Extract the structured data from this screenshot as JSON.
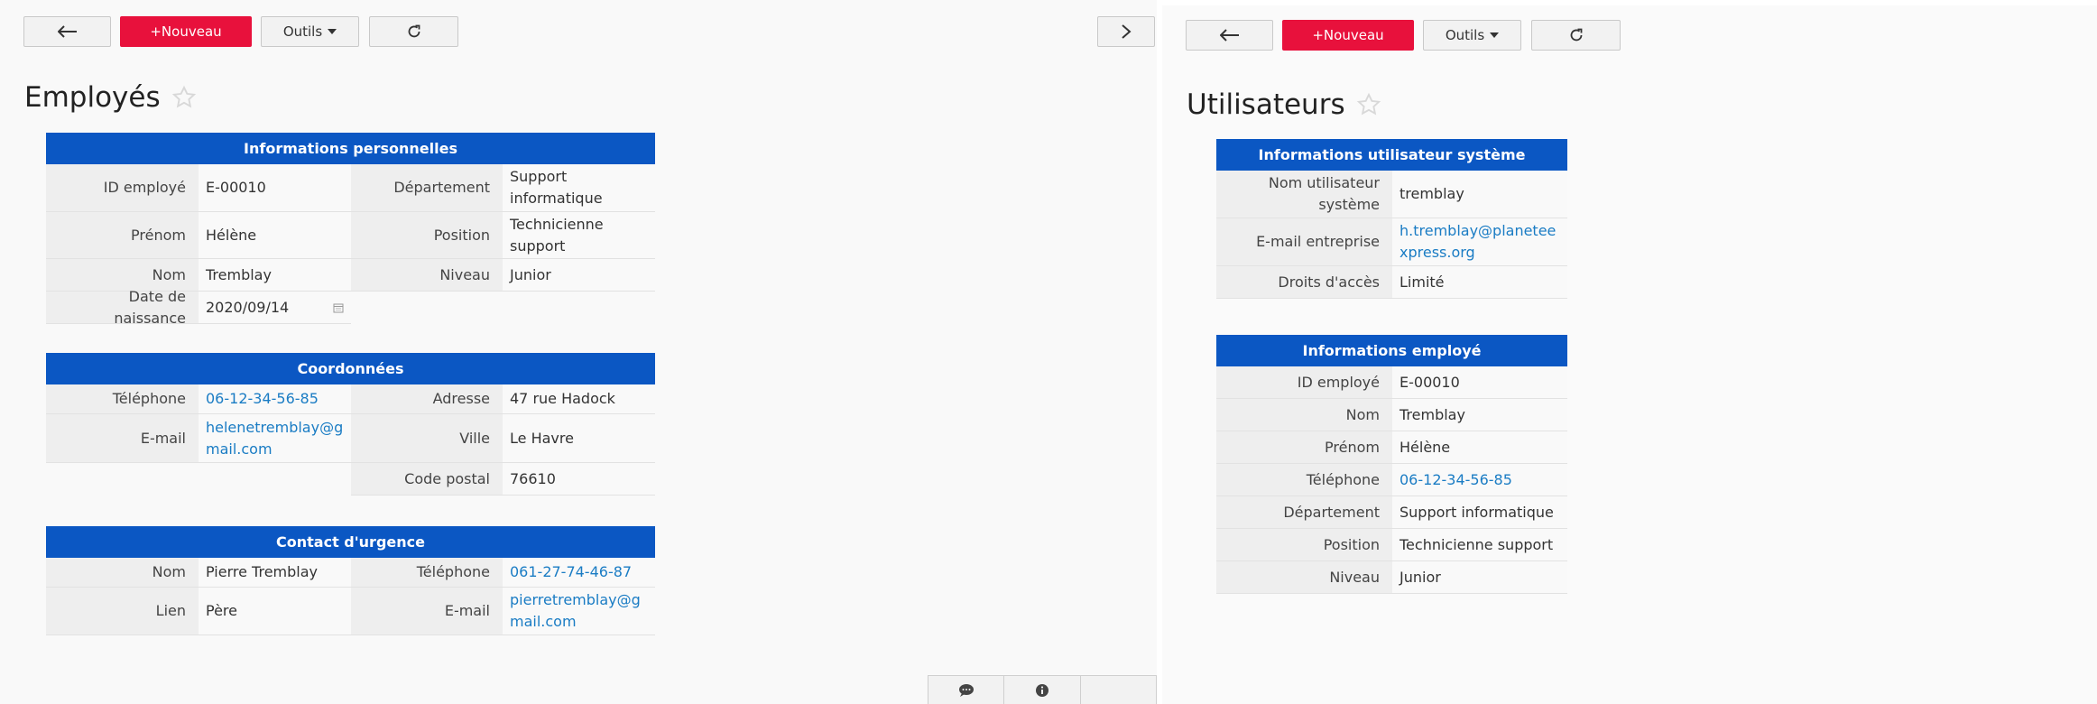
{
  "colors": {
    "accent_red": "#e8113c",
    "header_blue": "#0b57c3",
    "link_blue": "#1a7cc4"
  },
  "left": {
    "toolbar": {
      "back_icon": "arrow-left-icon",
      "new_label": "+Nouveau",
      "tools_label": "Outils",
      "refresh_icon": "refresh-icon",
      "forward_icon": "chevron-right-icon"
    },
    "title": "Employés",
    "personal": {
      "header": "Informations personnelles",
      "employee_id_label": "ID employé",
      "employee_id": "E-00010",
      "department_label": "Département",
      "department": "Support informatique",
      "first_name_label": "Prénom",
      "first_name": "Hélène",
      "position_label": "Position",
      "position": "Technicienne support",
      "last_name_label": "Nom",
      "last_name": "Tremblay",
      "level_label": "Niveau",
      "level": "Junior",
      "birthdate_label": "Date de naissance",
      "birthdate": "2020/09/14"
    },
    "contact": {
      "header": "Coordonnées",
      "phone_label": "Téléphone",
      "phone": "06-12-34-56-85",
      "address_label": "Adresse",
      "address": "47 rue Hadock",
      "email_label": "E-mail",
      "email": "helenetremblay@gmail.com",
      "city_label": "Ville",
      "city": "Le Havre",
      "postal_label": "Code postal",
      "postal": "76610"
    },
    "emergency": {
      "header": "Contact d'urgence",
      "name_label": "Nom",
      "name": "Pierre Tremblay",
      "phone_label": "Téléphone",
      "phone": "061-27-74-46-87",
      "relation_label": "Lien",
      "relation": "Père",
      "email_label": "E-mail",
      "email": "pierretremblay@gmail.com"
    },
    "bottom_bar": {
      "comment_icon": "comment-icon",
      "info_icon": "info-icon"
    }
  },
  "right": {
    "toolbar": {
      "back_icon": "arrow-left-icon",
      "new_label": "+Nouveau",
      "tools_label": "Outils",
      "refresh_icon": "refresh-icon"
    },
    "title": "Utilisateurs",
    "system": {
      "header": "Informations utilisateur système",
      "username_label": "Nom utilisateur système",
      "username": "tremblay",
      "work_email_label": "E-mail entreprise",
      "work_email": "h.tremblay@planeteexpress.org",
      "access_label": "Droits d'accès",
      "access": "Limité"
    },
    "employee": {
      "header": "Informations employé",
      "employee_id_label": "ID employé",
      "employee_id": "E-00010",
      "last_name_label": "Nom",
      "last_name": "Tremblay",
      "first_name_label": "Prénom",
      "first_name": "Hélène",
      "phone_label": "Téléphone",
      "phone": "06-12-34-56-85",
      "department_label": "Département",
      "department": "Support informatique",
      "position_label": "Position",
      "position": "Technicienne support",
      "level_label": "Niveau",
      "level": "Junior"
    }
  }
}
